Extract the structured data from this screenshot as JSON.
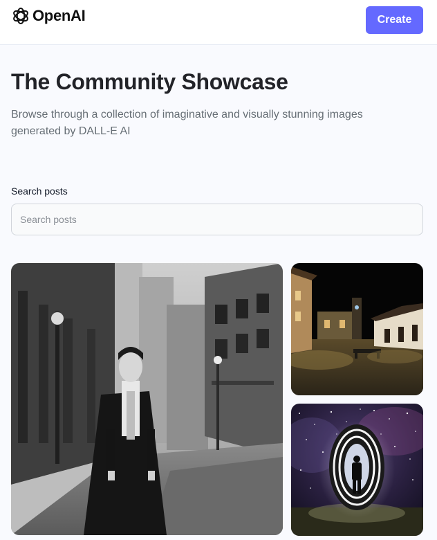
{
  "header": {
    "logo_text": "OpenAI",
    "create_label": "Create"
  },
  "main": {
    "title": "The Community Showcase",
    "description": "Browse through a collection of imaginative and visually stunning images generated by DALL-E AI"
  },
  "search": {
    "label": "Search posts",
    "placeholder": "Search posts",
    "value": ""
  },
  "posts": [
    {
      "subject": "vampire-on-city-street"
    },
    {
      "subject": "night-village-plaza"
    },
    {
      "subject": "portal-under-starry-sky"
    }
  ],
  "colors": {
    "accent": "#6469ff",
    "page_bg": "#f9fafe",
    "title": "#222328",
    "muted_text": "#666e75"
  }
}
